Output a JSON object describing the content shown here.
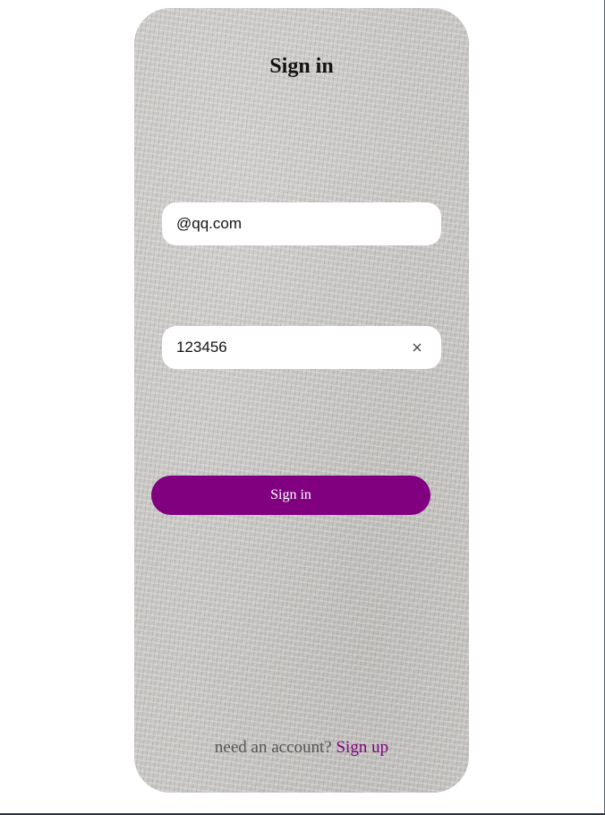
{
  "form": {
    "title": "Sign in",
    "email": {
      "value": "@qq.com",
      "placeholder": ""
    },
    "password": {
      "value": "123456",
      "placeholder": ""
    },
    "clear_icon": "close-icon",
    "submit_label": "Sign in"
  },
  "footer": {
    "prompt": "need an account?",
    "link_label": "Sign up"
  },
  "colors": {
    "accent": "#800080",
    "button_text": "#ffffff",
    "field_background": "#ffffff",
    "card_texture": "#c7c5c2"
  }
}
